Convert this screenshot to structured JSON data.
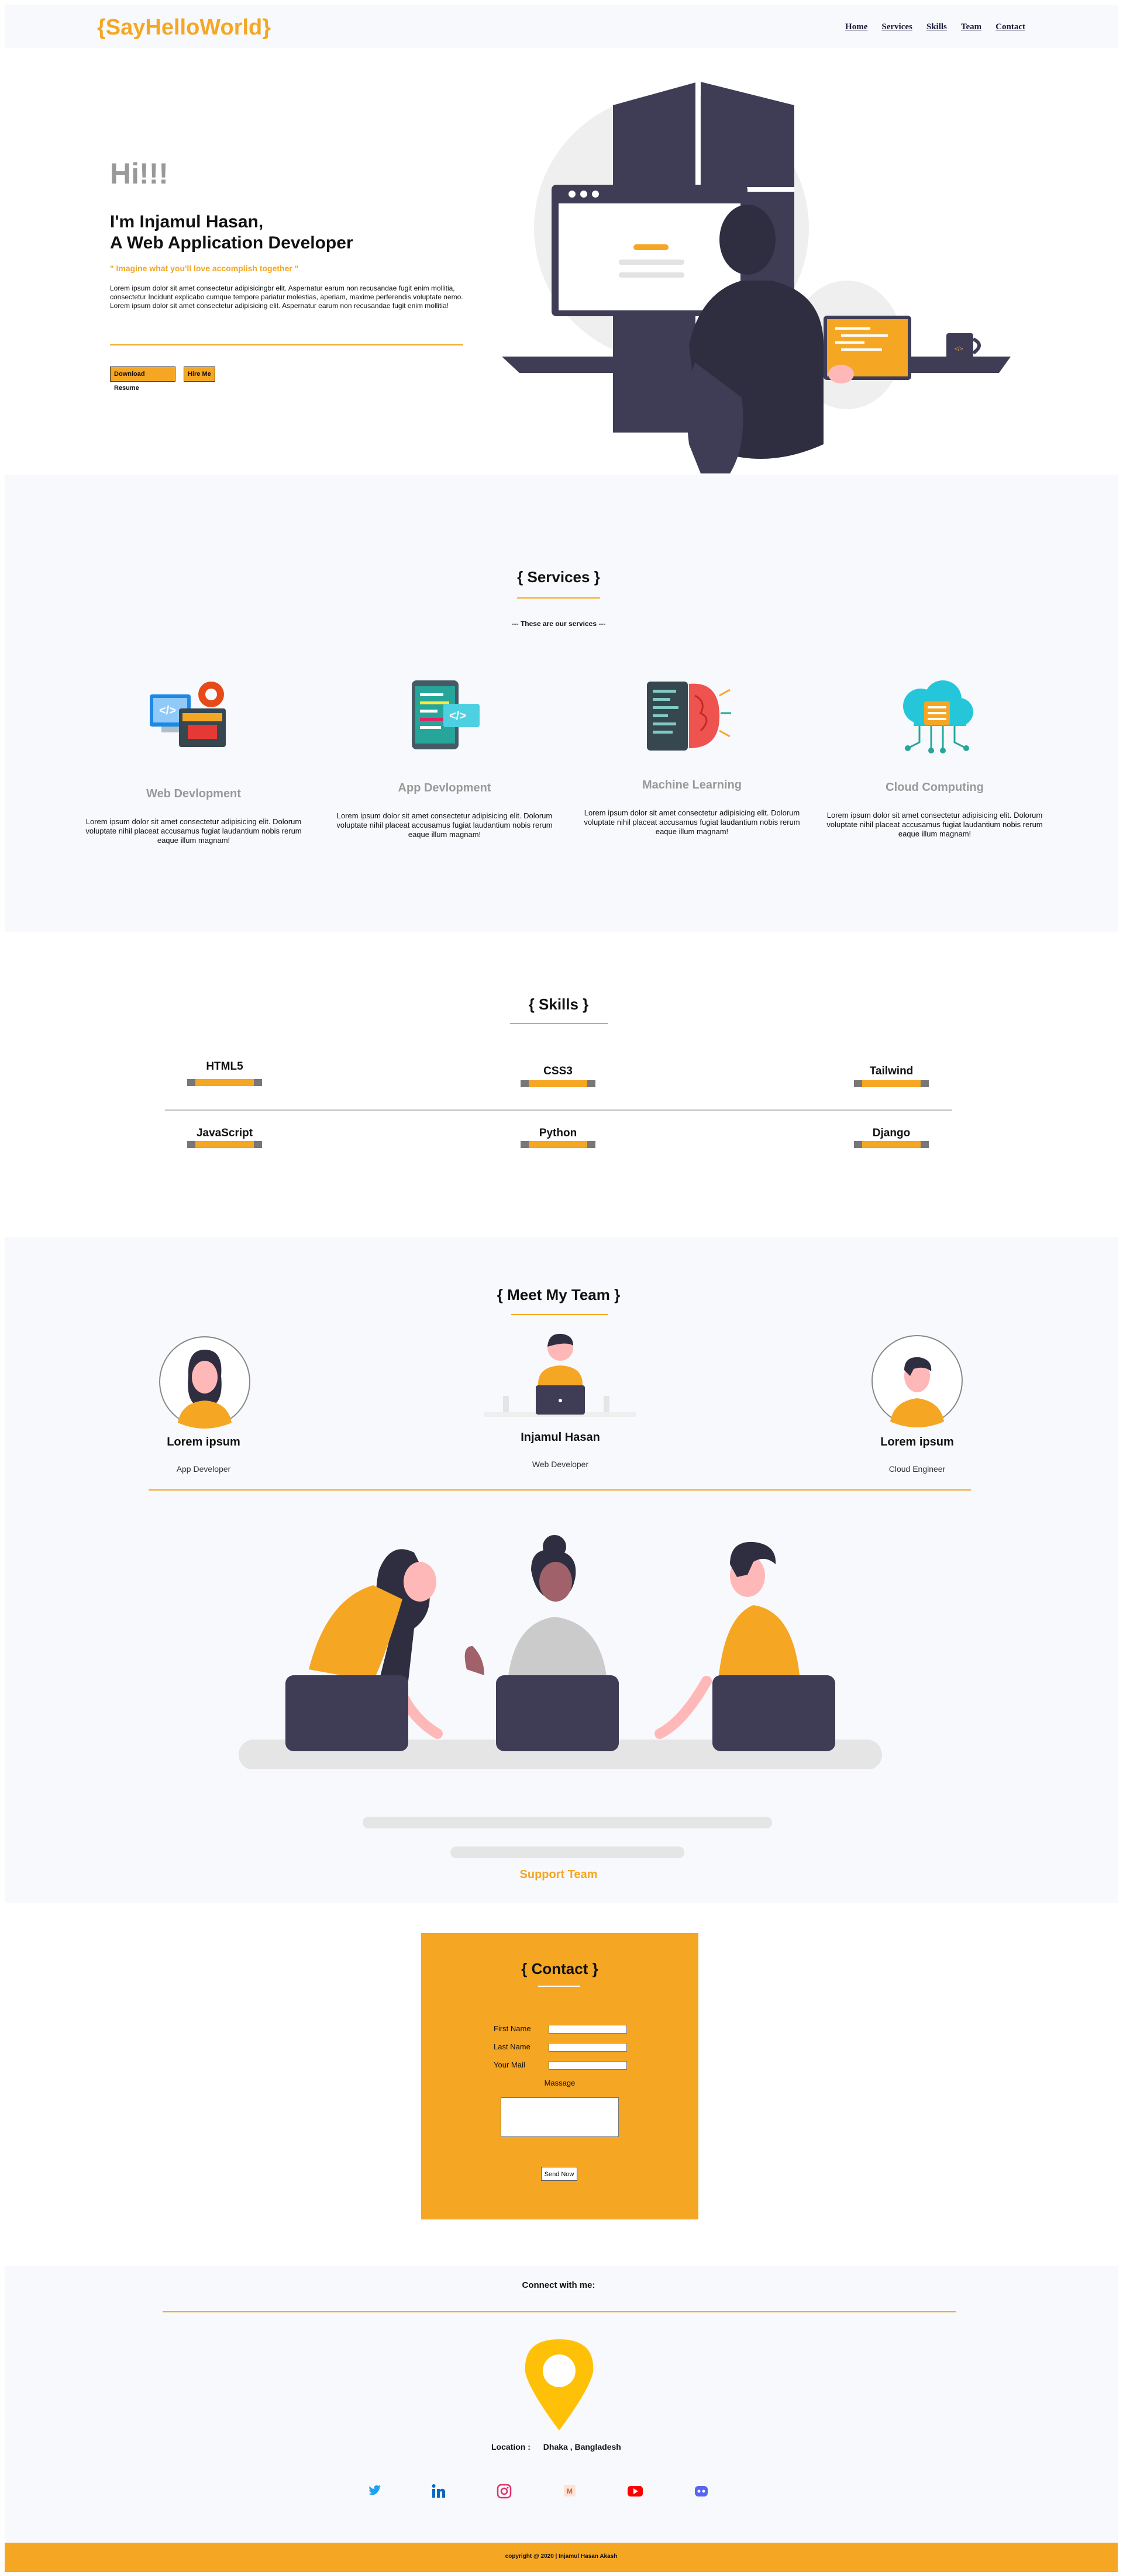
{
  "nav": {
    "logo": "{SayHelloWorld}",
    "links": [
      "Home",
      "Services",
      "Skills",
      "Team",
      "Contact"
    ]
  },
  "hero": {
    "greeting": "Hi!!!",
    "name_line1": "I'm Injamul Hasan,",
    "name_line2": "A Web Application Developer",
    "quote": "\" Imagine what you'll love accomplish together \"",
    "paragraph": "Lorem ipsum dolor sit amet consectetur adipisicingbr elit. Aspernatur earum non recusandae fugit enim mollitia, consectetur Incidunt explicabo cumque tempore pariatur molestias, aperiam, maxime perferendis voluptate nemo. Lorem ipsum dolor sit amet consectetur adipisicing elit. Aspernatur earum non recusandae fugit enim mollitia!",
    "download_label": "Download Resume",
    "hire_label": "Hire Me"
  },
  "services": {
    "title": "{ Services }",
    "subtitle": "--- These are our services ---",
    "items": [
      {
        "name": "Web Devlopment",
        "icon": "web-dev-icon",
        "desc": "Lorem ipsum dolor sit amet consectetur adipisicing elit. Dolorum voluptate nihil placeat accusamus fugiat laudantium nobis rerum eaque illum magnam!"
      },
      {
        "name": "App Devlopment",
        "icon": "app-dev-icon",
        "desc": "Lorem ipsum dolor sit amet consectetur adipisicing elit. Dolorum voluptate nihil placeat accusamus fugiat laudantium nobis rerum eaque illum magnam!"
      },
      {
        "name": "Machine Learning",
        "icon": "machine-learning-icon",
        "desc": "Lorem ipsum dolor sit amet consectetur adipisicing elit. Dolorum voluptate nihil placeat accusamus fugiat laudantium nobis rerum eaque illum magnam!"
      },
      {
        "name": "Cloud Computing",
        "icon": "cloud-computing-icon",
        "desc": "Lorem ipsum dolor sit amet consectetur adipisicing elit. Dolorum voluptate nihil placeat accusamus fugiat laudantium nobis rerum eaque illum magnam!"
      }
    ]
  },
  "skills": {
    "title": "{ Skills }",
    "items": [
      "HTML5",
      "CSS3",
      "Tailwind",
      "JavaScript",
      "Python",
      "Django"
    ]
  },
  "team": {
    "title": "{ Meet My Team }",
    "members": [
      {
        "name": "Lorem ipsum",
        "role": "App Developer"
      },
      {
        "name": "Injamul Hasan",
        "role": "Web Developer"
      },
      {
        "name": "Lorem ipsum",
        "role": "Cloud Engineer"
      }
    ],
    "support": "Support Team"
  },
  "contact": {
    "title": "{ Contact }",
    "first_name": "First Name",
    "last_name": "Last Name",
    "mail": "Your Mail",
    "message": "Massage",
    "send": "Send Now"
  },
  "footer": {
    "connect": "Connect with me:",
    "location_label": "Location :",
    "location_value": "Dhaka , Bangladesh",
    "social": [
      "twitter-icon",
      "linkedin-icon",
      "instagram-icon",
      "medium-icon",
      "youtube-icon",
      "discord-icon"
    ],
    "copyright": "copyright @ 2020 | Injamul Hasan Akash"
  },
  "colors": {
    "accent": "#f5a623",
    "dark": "#3f3d56",
    "bg_gray": "#f8f9fc"
  }
}
